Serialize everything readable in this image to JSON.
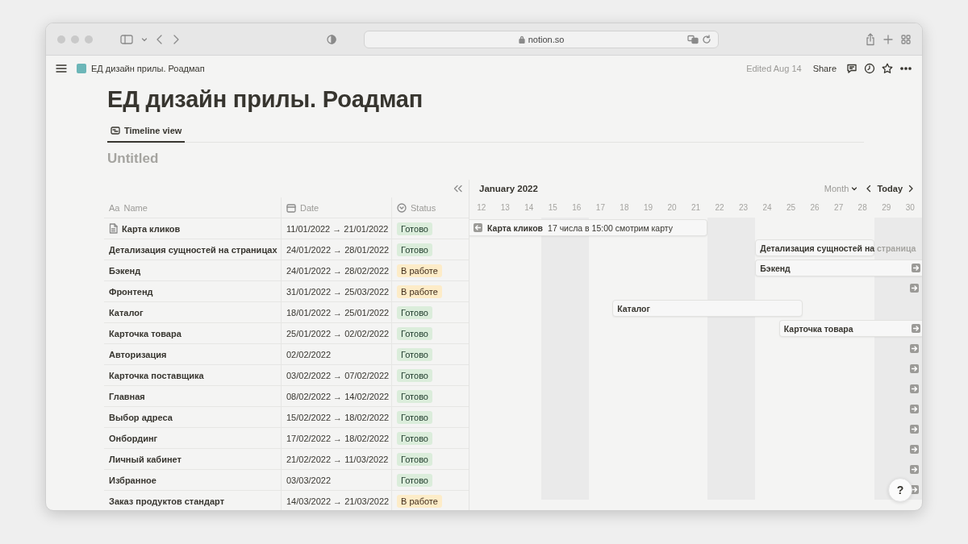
{
  "browser": {
    "address": "notion.so"
  },
  "topbar": {
    "breadcrumb": "ЕД дизайн прилы. Роадмап",
    "edited": "Edited Aug 14",
    "share": "Share"
  },
  "page": {
    "title": "ЕД дизайн прилы. Роадмап",
    "views": [
      {
        "label": "Timeline view",
        "selected": true
      }
    ],
    "database_title": "Untitled"
  },
  "table": {
    "columns": [
      {
        "kind": "title",
        "glyph": "Aa",
        "label": "Name"
      },
      {
        "kind": "date",
        "label": "Date"
      },
      {
        "kind": "status",
        "label": "Status"
      }
    ],
    "rows": [
      {
        "name": "Карта кликов",
        "page_icon": true,
        "date": "11/01/2022 → 21/01/2022",
        "status": {
          "label": "Готово",
          "color": "#dbeddb"
        }
      },
      {
        "name": "Детализация сущностей на страницах",
        "page_icon": false,
        "date": "24/01/2022 → 28/01/2022",
        "status": {
          "label": "Готово",
          "color": "#dbeddb"
        }
      },
      {
        "name": "Бэкенд",
        "page_icon": false,
        "date": "24/01/2022 → 28/02/2022",
        "status": {
          "label": "В работе",
          "color": "#fdecc8"
        }
      },
      {
        "name": "Фронтенд",
        "page_icon": false,
        "date": "31/01/2022 → 25/03/2022",
        "status": {
          "label": "В работе",
          "color": "#fdecc8"
        }
      },
      {
        "name": "Каталог",
        "page_icon": false,
        "date": "18/01/2022 → 25/01/2022",
        "status": {
          "label": "Готово",
          "color": "#dbeddb"
        }
      },
      {
        "name": "Карточка товара",
        "page_icon": false,
        "date": "25/01/2022 → 02/02/2022",
        "status": {
          "label": "Готово",
          "color": "#dbeddb"
        }
      },
      {
        "name": "Авторизация",
        "page_icon": false,
        "date": "02/02/2022",
        "status": {
          "label": "Готово",
          "color": "#dbeddb"
        }
      },
      {
        "name": "Карточка поставщика",
        "page_icon": false,
        "date": "03/02/2022 → 07/02/2022",
        "status": {
          "label": "Готово",
          "color": "#dbeddb"
        }
      },
      {
        "name": "Главная",
        "page_icon": false,
        "date": "08/02/2022 → 14/02/2022",
        "status": {
          "label": "Готово",
          "color": "#dbeddb"
        }
      },
      {
        "name": "Выбор адреса",
        "page_icon": false,
        "date": "15/02/2022 → 18/02/2022",
        "status": {
          "label": "Готово",
          "color": "#dbeddb"
        }
      },
      {
        "name": "Онбординг",
        "page_icon": false,
        "date": "17/02/2022 → 18/02/2022",
        "status": {
          "label": "Готово",
          "color": "#dbeddb"
        }
      },
      {
        "name": "Личный кабинет",
        "page_icon": false,
        "date": "21/02/2022 → 11/03/2022",
        "status": {
          "label": "Готово",
          "color": "#dbeddb"
        }
      },
      {
        "name": "Избранное",
        "page_icon": false,
        "date": "03/03/2022",
        "status": {
          "label": "Готово",
          "color": "#dbeddb"
        }
      },
      {
        "name": "Заказ продуктов стандарт",
        "page_icon": false,
        "date": "14/03/2022 → 21/03/2022",
        "status": {
          "label": "В работе",
          "color": "#fdecc8"
        }
      }
    ]
  },
  "timeline": {
    "month": "January 2022",
    "scale": "Month",
    "today": "Today",
    "days": [
      {
        "label": "12",
        "weekend": false
      },
      {
        "label": "13",
        "weekend": false
      },
      {
        "label": "14",
        "weekend": false
      },
      {
        "label": "15",
        "weekend": true
      },
      {
        "label": "16",
        "weekend": true
      },
      {
        "label": "17",
        "weekend": false
      },
      {
        "label": "18",
        "weekend": false
      },
      {
        "label": "19",
        "weekend": false
      },
      {
        "label": "20",
        "weekend": false
      },
      {
        "label": "21",
        "weekend": false
      },
      {
        "label": "22",
        "weekend": true
      },
      {
        "label": "23",
        "weekend": true
      },
      {
        "label": "24",
        "weekend": false
      },
      {
        "label": "25",
        "weekend": false
      },
      {
        "label": "26",
        "weekend": false
      },
      {
        "label": "27",
        "weekend": false
      },
      {
        "label": "28",
        "weekend": false
      },
      {
        "label": "29",
        "weekend": true
      },
      {
        "label": "30",
        "weekend": true
      }
    ],
    "rows": [
      {
        "kind": "bar",
        "label": "Карта кликов",
        "note": "17 числа в 15:00 смотрим карту"
      },
      {
        "kind": "bar",
        "label": "Детализация сущностей на",
        "overflow": "страница"
      },
      {
        "kind": "bar",
        "label": "Бэкенд"
      },
      {
        "kind": "offscreen"
      },
      {
        "kind": "bar",
        "label": "Каталог"
      },
      {
        "kind": "bar",
        "label": "Карточка товара"
      },
      {
        "kind": "offscreen"
      },
      {
        "kind": "offscreen"
      },
      {
        "kind": "offscreen"
      },
      {
        "kind": "offscreen"
      },
      {
        "kind": "offscreen"
      },
      {
        "kind": "offscreen"
      },
      {
        "kind": "offscreen"
      },
      {
        "kind": "offscreen"
      }
    ]
  },
  "help": "?"
}
